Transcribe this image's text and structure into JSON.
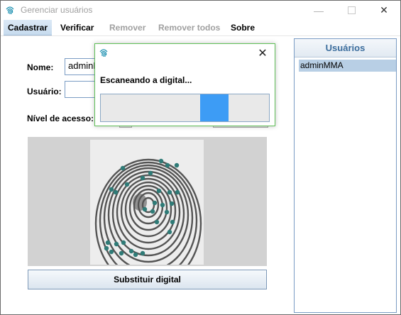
{
  "window": {
    "title": "Gerenciar usuários"
  },
  "menu": [
    {
      "label": "Cadastrar",
      "state": "active"
    },
    {
      "label": "Verificar",
      "state": "enabled"
    },
    {
      "label": "Remover",
      "state": "disabled"
    },
    {
      "label": "Remover todos",
      "state": "disabled"
    },
    {
      "label": "Sobre",
      "state": "enabled"
    }
  ],
  "form": {
    "nome_label": "Nome:",
    "nome_value": "adminMMA",
    "usuario_label": "Usuário:",
    "usuario_value": "",
    "nivel_label": "Nível de acesso:",
    "substituir_label": "Substituir digital"
  },
  "users": {
    "header": "Usuários",
    "items": [
      "adminMMA"
    ]
  },
  "dialog": {
    "message": "Escaneando a digital...",
    "progress_indeterminate_segment": {
      "start_fraction": 0.59,
      "end_fraction": 0.76
    }
  },
  "colors": {
    "accent_blue": "#3d9cf5",
    "dialog_border": "#5fbf57",
    "users_header_text": "#3a6c9c",
    "selection": "#b8cfe5",
    "minutia_points": "#2f7b77"
  },
  "icons": {
    "app": "fingerprint-icon",
    "close": "close-icon",
    "minimize": "minimize-icon",
    "maximize": "maximize-icon"
  }
}
